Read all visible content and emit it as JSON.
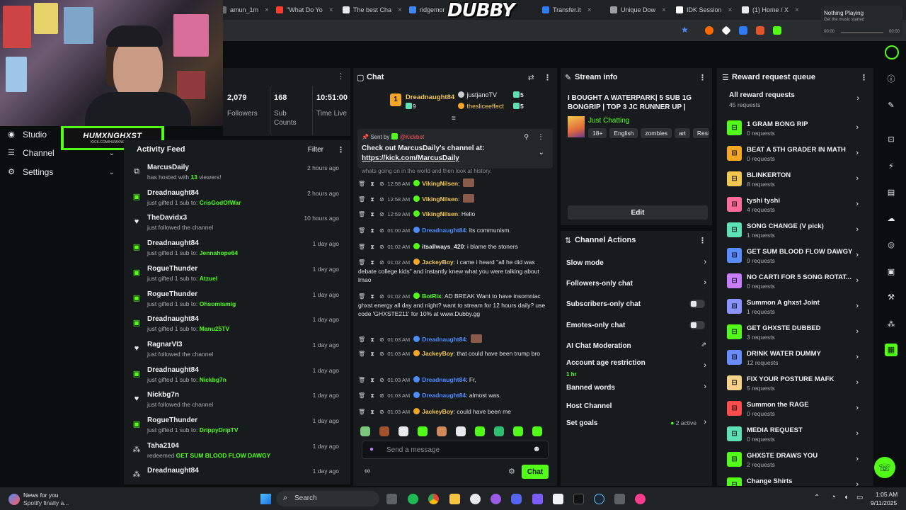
{
  "browser": {
    "tabs": [
      {
        "label": "amun_1m",
        "color": "#6b6e72"
      },
      {
        "label": "\"What Do Yo",
        "color": "#ff3b30"
      },
      {
        "label": "The best Cha",
        "color": "#e8eaeb"
      },
      {
        "label": "ridgemont",
        "color": "#4285f4"
      },
      {
        "label": "Transfer.it",
        "color": "#2f7bf5"
      },
      {
        "label": "Unique Dow",
        "color": "#9aa0a6"
      },
      {
        "label": "IDK Session",
        "color": "#ffffff"
      },
      {
        "label": "(1) Home / X",
        "color": "#e8eaeb"
      }
    ],
    "overlay_brand": "DUBBY"
  },
  "music": {
    "title": "Nothing Playing",
    "subtitle": "Get the music started",
    "time_start": "00:00",
    "time_end": "00:00"
  },
  "stream_logo": {
    "name": "HUMXNGHXST",
    "url": "KICK.COM/HUMXNGHXST"
  },
  "sidebar": {
    "items": [
      {
        "label": "Studio",
        "icon": "studio-icon"
      },
      {
        "label": "Channel",
        "icon": "channel-icon"
      },
      {
        "label": "Settings",
        "icon": "gear-icon"
      }
    ]
  },
  "stats": [
    {
      "value": "2,079",
      "label": "Followers"
    },
    {
      "value": "168",
      "label": "Sub Counts"
    },
    {
      "value": "10:51:00",
      "label": "Time Live"
    }
  ],
  "activity": {
    "title": "Activity Feed",
    "filter_label": "Filter",
    "rows": [
      {
        "type": "host",
        "name": "MarcusDaily",
        "pre": "has hosted with ",
        "hl": "13",
        "post": " viewers!",
        "time": "2 hours ago"
      },
      {
        "type": "gift",
        "name": "Dreadnaught84",
        "pre": "just gifted 1 sub to: ",
        "hl": "CrisGodOfWar",
        "post": "",
        "time": "2 hours ago"
      },
      {
        "type": "follow",
        "name": "TheDavidx3",
        "pre": "just followed the channel",
        "hl": "",
        "post": "",
        "time": "10 hours ago"
      },
      {
        "type": "gift",
        "name": "Dreadnaught84",
        "pre": "just gifted 1 sub to: ",
        "hl": "Jennahope64",
        "post": "",
        "time": "1 day ago"
      },
      {
        "type": "gift",
        "name": "RogueThunder",
        "pre": "just gifted 1 sub to: ",
        "hl": "Atzuel",
        "post": "",
        "time": "1 day ago"
      },
      {
        "type": "gift",
        "name": "RogueThunder",
        "pre": "just gifted 1 sub to: ",
        "hl": "Ohsomiamig",
        "post": "",
        "time": "1 day ago"
      },
      {
        "type": "gift",
        "name": "Dreadnaught84",
        "pre": "just gifted 1 sub to: ",
        "hl": "Manu25TV",
        "post": "",
        "time": "1 day ago"
      },
      {
        "type": "follow",
        "name": "RagnarVI3",
        "pre": "just followed the channel",
        "hl": "",
        "post": "",
        "time": "1 day ago"
      },
      {
        "type": "gift",
        "name": "Dreadnaught84",
        "pre": "just gifted 1 sub to: ",
        "hl": "Nickbg7n",
        "post": "",
        "time": "1 day ago"
      },
      {
        "type": "follow",
        "name": "Nickbg7n",
        "pre": "just followed the channel",
        "hl": "",
        "post": "",
        "time": "1 day ago"
      },
      {
        "type": "gift",
        "name": "RogueThunder",
        "pre": "just gifted 1 sub to: ",
        "hl": "DrippyDripTV",
        "post": "",
        "time": "1 day ago"
      },
      {
        "type": "redeem",
        "name": "Taha2104",
        "pre": "redeemed ",
        "hl": "GET SUM BLOOD FLOW DAWGY",
        "post": "",
        "time": "1 day ago"
      },
      {
        "type": "redeem",
        "name": "Dreadnaught84",
        "pre": "",
        "hl": "",
        "post": "",
        "time": "1 day ago"
      }
    ]
  },
  "chat": {
    "title": "Chat",
    "leaders": [
      {
        "rank": "1",
        "name": "Dreadnaught84",
        "count": "9"
      },
      {
        "rank": "",
        "name": "justjanoTV",
        "count": "5"
      },
      {
        "rank": "",
        "name": "thesliceeffect",
        "count": "5"
      }
    ],
    "pinned": {
      "sent_by": "Sent by",
      "sender": "@Kickbot",
      "text": "Check out MarcusDaily's channel at:",
      "link": "https://kick.com/MarcusDaily",
      "under": "whats going on in the world and then look at history."
    },
    "messages": [
      {
        "time": "12:58 AM",
        "user": "VikingNilsen",
        "color": "#f2c94c",
        "text": ""
      },
      {
        "time": "12:58 AM",
        "user": "VikingNilsen",
        "color": "#f2c94c",
        "text": ""
      },
      {
        "time": "12:59 AM",
        "user": "VikingNilsen",
        "color": "#f2c94c",
        "text": "Hello"
      },
      {
        "time": "01:00 AM",
        "user": "Dreadnaught84",
        "color": "#4d8cff",
        "text": "its communism."
      },
      {
        "time": "01:02 AM",
        "user": "itsallways_420",
        "color": "#e8eaeb",
        "text": "i blame the stoners"
      },
      {
        "time": "01:02 AM",
        "user": "JackeyBoy",
        "color": "#f2c94c",
        "text": "i came i heard \"all he did was debate college kids\" and instantly knew what you were talking about lmao"
      },
      {
        "time": "01:02 AM",
        "user": "BotRix",
        "color": "#53fc18",
        "text": "AD BREAK Want to have insomniac ghxst energy all day and night? want to stream for 12 hours daily? use code 'GHXSTE211' for 10% at www.Dubby.gg"
      },
      {
        "time": "01:03 AM",
        "user": "Dreadnaught84",
        "color": "#4d8cff",
        "text": ""
      },
      {
        "time": "01:03 AM",
        "user": "JackeyBoy",
        "color": "#f2c94c",
        "text": "that could have been trump bro"
      },
      {
        "time": "01:03 AM",
        "user": "Dreadnaught84",
        "color": "#4d8cff",
        "text": "Fr,"
      },
      {
        "time": "01:03 AM",
        "user": "Dreadnaught84",
        "color": "#4d8cff",
        "text": "almost was."
      },
      {
        "time": "01:03 AM",
        "user": "JackeyBoy",
        "color": "#f2c94c",
        "text": "could have been me"
      }
    ],
    "input_placeholder": "Send a message",
    "send_label": "Chat"
  },
  "stream_info": {
    "title": "Stream info",
    "stream_title": "I BOUGHT A WATERPARK| 5 SUB 1G BONGRIP | TOP 3 JC RUNNER UP | WERE...",
    "category": "Just Chatting",
    "tags": [
      "18+",
      "English",
      "zombies",
      "art",
      "Resi"
    ],
    "edit_label": "Edit"
  },
  "channel_actions": {
    "title": "Channel Actions",
    "items": [
      {
        "label": "Slow mode",
        "kind": "chev",
        "sub": ""
      },
      {
        "label": "Followers-only chat",
        "kind": "chev",
        "sub": ""
      },
      {
        "label": "Subscribers-only chat",
        "kind": "toggle",
        "sub": ""
      },
      {
        "label": "Emotes-only chat",
        "kind": "toggle",
        "sub": ""
      },
      {
        "label": "AI Chat Moderation",
        "kind": "ext",
        "sub": ""
      },
      {
        "label": "Account age restriction",
        "kind": "chev",
        "sub": "1 hr"
      },
      {
        "label": "Banned words",
        "kind": "chev",
        "sub": ""
      },
      {
        "label": "Host Channel",
        "kind": "none",
        "sub": ""
      },
      {
        "label": "Set goals",
        "kind": "goal",
        "sub": "2 active"
      }
    ]
  },
  "rewards": {
    "title": "Reward request queue",
    "all_label": "All reward requests",
    "all_count": "45 requests",
    "items": [
      {
        "title": "1 GRAM BONG RIP",
        "count": "0 requests",
        "color": "#53fc18"
      },
      {
        "title": "BEAT A 5TH GRADER IN MATH",
        "count": "0 requests",
        "color": "#f5a623"
      },
      {
        "title": "BLINKERTON",
        "count": "8 requests",
        "color": "#f2c94c"
      },
      {
        "title": "tyshi tyshi",
        "count": "4 requests",
        "color": "#ff6b9a"
      },
      {
        "title": "SONG CHANGE (V pick)",
        "count": "1 requests",
        "color": "#5ee0b5"
      },
      {
        "title": "GET SUM BLOOD FLOW DAWGY",
        "count": "9 requests",
        "color": "#5b8cff"
      },
      {
        "title": "NO CARTI FOR 5 SONG ROTAT...",
        "count": "0 requests",
        "color": "#c77dff"
      },
      {
        "title": "Summon A ghxst Joint",
        "count": "1 requests",
        "color": "#8a94ff"
      },
      {
        "title": "GET GHXSTE DUBBED",
        "count": "3 requests",
        "color": "#53fc18"
      },
      {
        "title": "DRINK WATER DUMMY",
        "count": "12 requests",
        "color": "#6b8cff"
      },
      {
        "title": "FIX YOUR POSTURE MAFK",
        "count": "5 requests",
        "color": "#f5d28a"
      },
      {
        "title": "Summon the RAGE",
        "count": "0 requests",
        "color": "#ff4d4d"
      },
      {
        "title": "MEDIA REQUEST",
        "count": "0 requests",
        "color": "#5ee0b5"
      },
      {
        "title": "GHXSTE DRAWS YOU",
        "count": "2 requests",
        "color": "#53fc18"
      },
      {
        "title": "Change Shirts",
        "count": "",
        "color": "#53fc18"
      }
    ]
  },
  "taskbar": {
    "news_title": "News for you",
    "news_sub": "Spotify finally a...",
    "search_placeholder": "Search",
    "time": "1:05 AM",
    "date": "9/11/2025"
  },
  "colors": {
    "accent": "#53fc18",
    "panel": "#181b1d",
    "bg": "#0b0e0f"
  }
}
